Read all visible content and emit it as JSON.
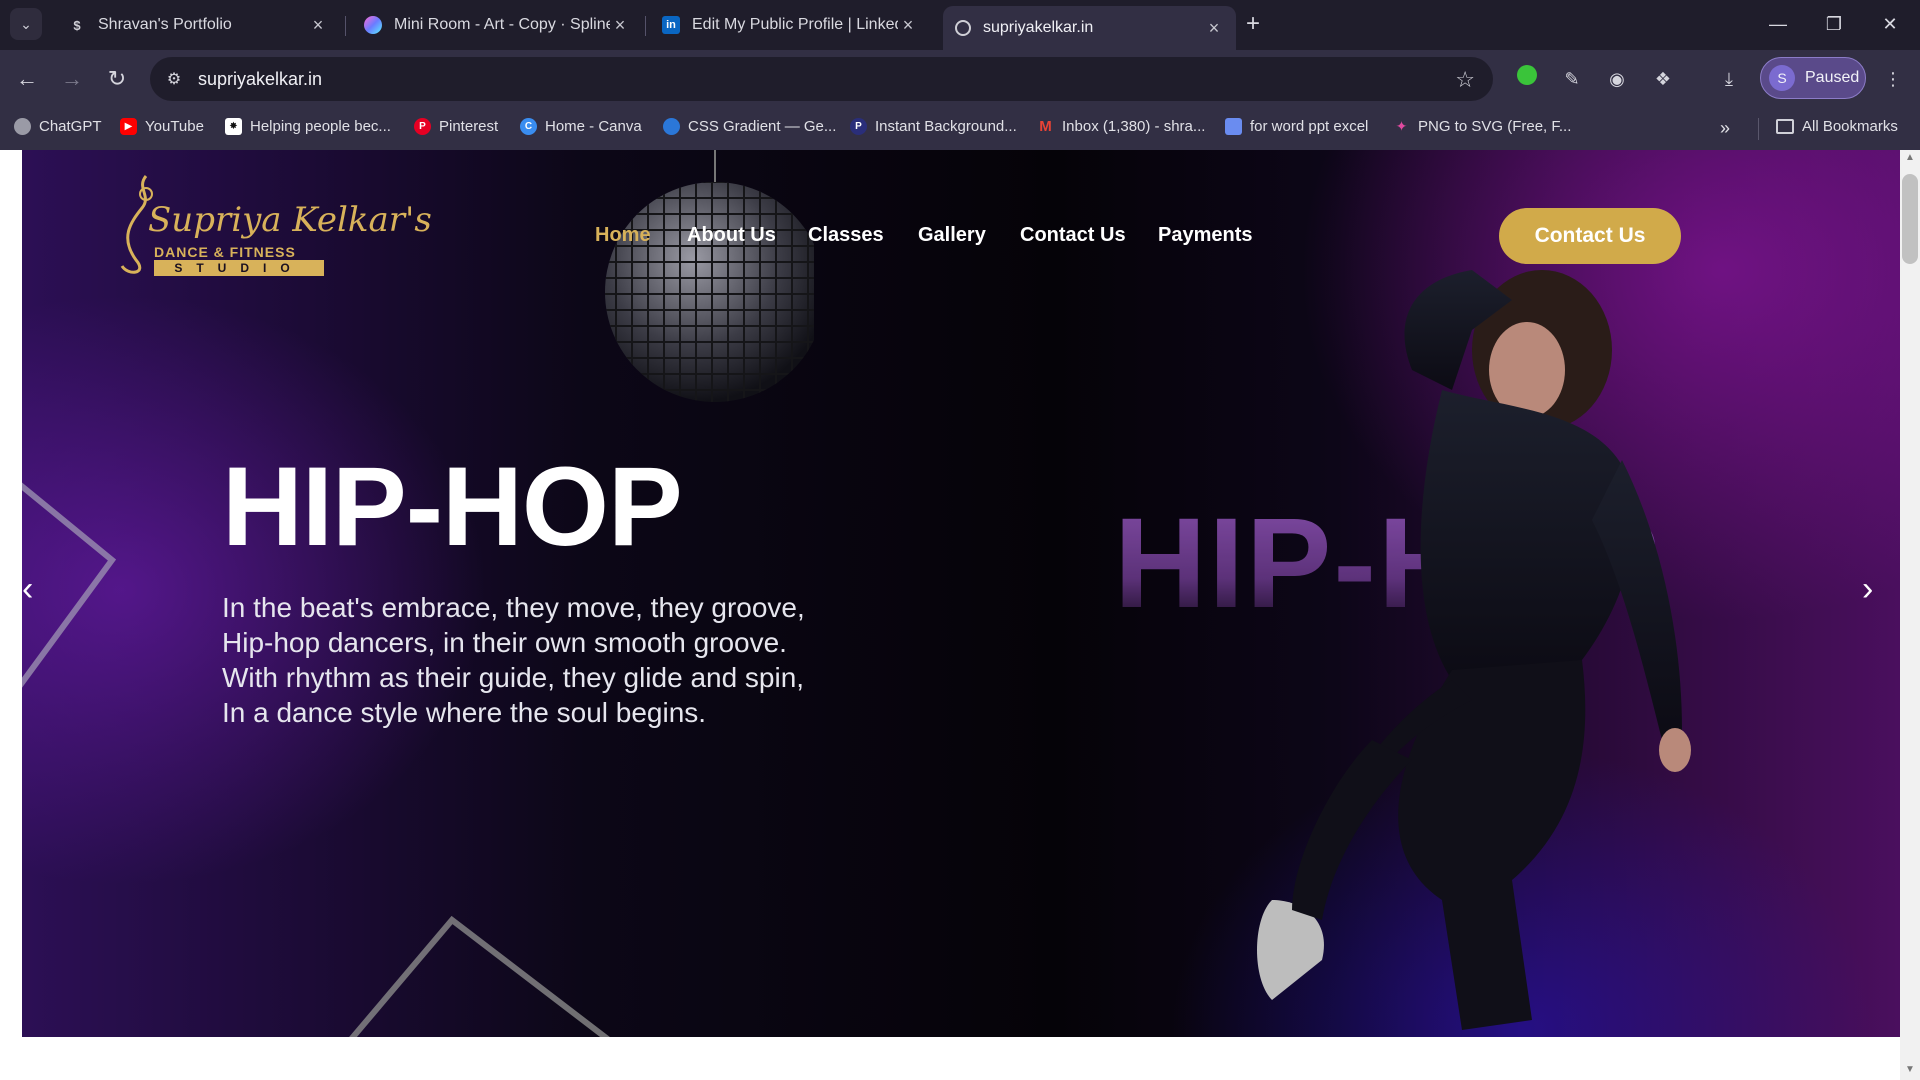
{
  "browser": {
    "tabs": [
      {
        "title": "Shravan's Portfolio",
        "icon": "dollar-icon",
        "active": false
      },
      {
        "title": "Mini Room - Art - Copy · Spline",
        "icon": "spline-icon",
        "active": false
      },
      {
        "title": "Edit My Public Profile | LinkedIn",
        "icon": "linkedin-icon",
        "active": false
      },
      {
        "title": "supriyakelkar.in",
        "icon": "globe-icon",
        "active": true
      }
    ],
    "url": "supriyakelkar.in",
    "profile_initial": "S",
    "profile_status": "Paused",
    "bookmarks": [
      {
        "label": "ChatGPT",
        "icon": "chatgpt-icon",
        "color": "#9a9aa6"
      },
      {
        "label": "YouTube",
        "icon": "youtube-icon",
        "color": "#ff0000"
      },
      {
        "label": "Helping people bec...",
        "icon": "openai-icon",
        "color": "#ffffff"
      },
      {
        "label": "Pinterest",
        "icon": "pinterest-icon",
        "color": "#e60023"
      },
      {
        "label": "Home - Canva",
        "icon": "canva-icon",
        "color": "#3a8df0"
      },
      {
        "label": "CSS Gradient — Ge...",
        "icon": "css-gradient-icon",
        "color": "#2b77d8"
      },
      {
        "label": "Instant Background...",
        "icon": "remove-bg-icon",
        "color": "#2a2e7a"
      },
      {
        "label": "Inbox (1,380) - shra...",
        "icon": "gmail-icon",
        "color": "#ea4335"
      },
      {
        "label": "for word ppt excel",
        "icon": "bookmark-app-icon",
        "color": "#6a8cf0"
      },
      {
        "label": "PNG to SVG (Free, F...",
        "icon": "png-svg-icon",
        "color": "#e04aa0"
      }
    ],
    "all_bookmarks": "All Bookmarks"
  },
  "site": {
    "logo": {
      "script": "Supriya Kelkar's",
      "line1": "DANCE & FITNESS",
      "line2": "STUDIO"
    },
    "nav": [
      "Home",
      "About Us",
      "Classes",
      "Gallery",
      "Contact Us",
      "Payments"
    ],
    "active_nav": "Home",
    "cta": "Contact Us",
    "hero": {
      "title": "HIP-HOP",
      "ghost_title": "HIP-HOP",
      "poem": [
        "In the beat's embrace, they move, they groove,",
        "Hip-hop dancers, in their own smooth groove.",
        "With rhythm as their guide, they glide and spin,",
        "In a dance style where the soul begins."
      ]
    },
    "colors": {
      "gold": "#d1aa4a",
      "purple": "#4a0f5e"
    }
  }
}
